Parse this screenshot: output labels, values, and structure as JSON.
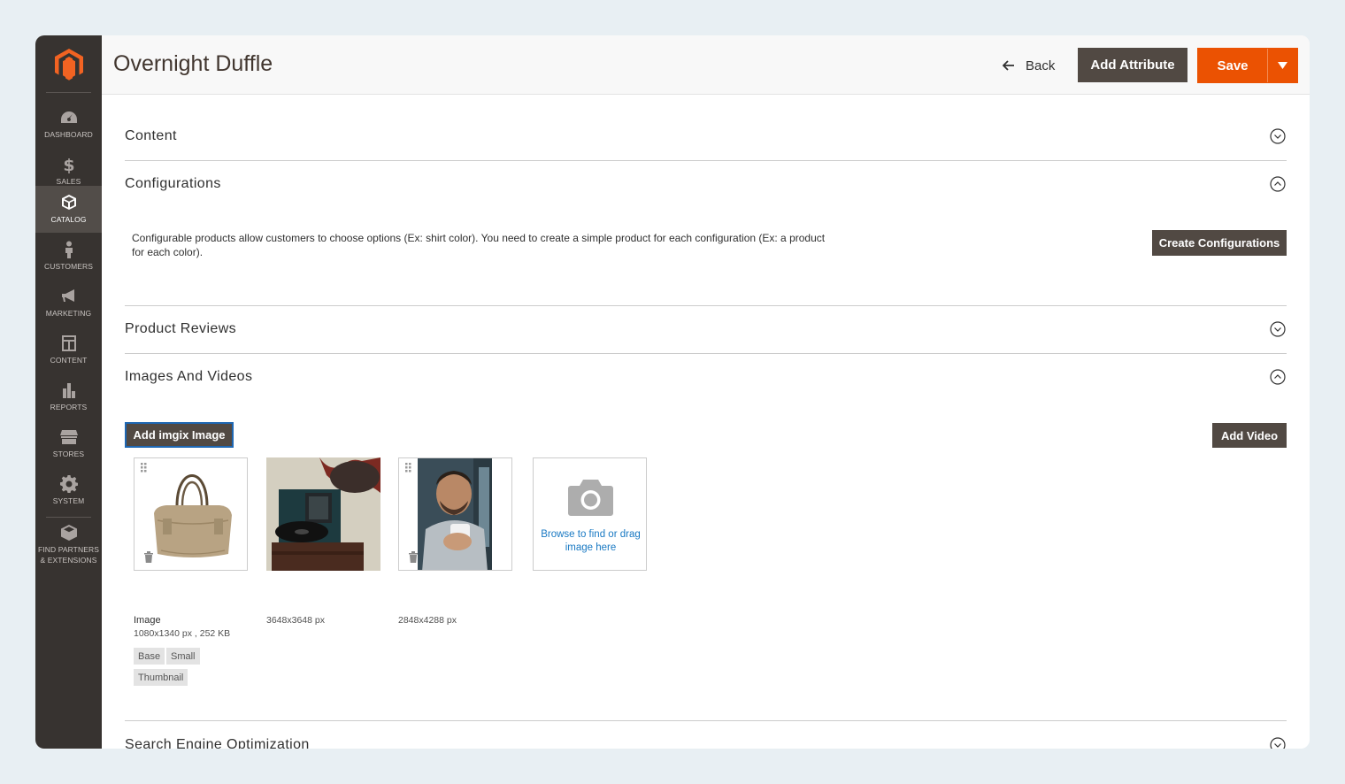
{
  "sidebar": {
    "items": [
      {
        "label": "DASHBOARD",
        "icon": "dashboard-icon"
      },
      {
        "label": "SALES",
        "icon": "dollar-icon"
      },
      {
        "label": "CATALOG",
        "icon": "box-icon",
        "active": true
      },
      {
        "label": "CUSTOMERS",
        "icon": "person-icon"
      },
      {
        "label": "MARKETING",
        "icon": "megaphone-icon"
      },
      {
        "label": "CONTENT",
        "icon": "layout-icon"
      },
      {
        "label": "REPORTS",
        "icon": "bar-chart-icon"
      },
      {
        "label": "STORES",
        "icon": "storefront-icon"
      },
      {
        "label": "SYSTEM",
        "icon": "gear-icon"
      },
      {
        "label": "FIND PARTNERS & EXTENSIONS",
        "icon": "cube-icon"
      }
    ]
  },
  "header": {
    "title": "Overnight Duffle",
    "back_label": "Back",
    "add_attribute_label": "Add Attribute",
    "save_label": "Save"
  },
  "sections": {
    "content": "Content",
    "configurations": "Configurations",
    "product_reviews": "Product Reviews",
    "images_videos": "Images And Videos",
    "seo": "Search Engine Optimization"
  },
  "configurations": {
    "description": "Configurable products allow customers to choose options (Ex: shirt color). You need to create a simple product for each configuration (Ex: a product for each color).",
    "create_label": "Create Configurations"
  },
  "images": {
    "add_imgix_label": "Add imgix Image",
    "add_video_label": "Add Video",
    "upload_text": "Browse to find or drag image here",
    "items": [
      {
        "caption": "Image",
        "meta": "1080x1340 px , 252 KB",
        "roles": [
          "Base",
          "Small",
          "Thumbnail"
        ]
      },
      {
        "meta": "3648x3648 px"
      },
      {
        "meta": "2848x4288 px"
      }
    ]
  },
  "colors": {
    "sidebar": "#373330",
    "accent": "#eb5202",
    "dark_button": "#514943",
    "link": "#1979c3"
  }
}
